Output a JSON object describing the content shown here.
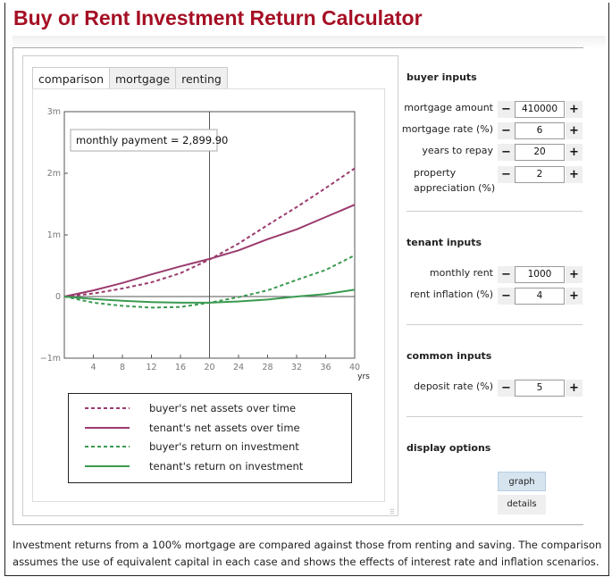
{
  "title": "Buy or Rent Investment Return Calculator",
  "tabs": [
    {
      "label": "comparison",
      "active": true
    },
    {
      "label": "mortgage"
    },
    {
      "label": "renting"
    }
  ],
  "annotation": "monthly payment = 2,899.90",
  "chart_data": {
    "type": "line",
    "xlabel": "yrs",
    "xlim": [
      0,
      40
    ],
    "ylim": [
      -1000000,
      3000000
    ],
    "xticks": [
      4,
      8,
      12,
      16,
      20,
      24,
      28,
      32,
      36,
      40
    ],
    "yticks": [
      {
        "v": 3000000,
        "label": "3m"
      },
      {
        "v": 2000000,
        "label": "2m"
      },
      {
        "v": 1000000,
        "label": "1m"
      },
      {
        "v": 0,
        "label": "0"
      },
      {
        "v": -1000000,
        "label": "−1m"
      }
    ],
    "vertical_marker_x": 20,
    "x": [
      0,
      4,
      8,
      12,
      16,
      20,
      24,
      28,
      32,
      36,
      40
    ],
    "series": [
      {
        "name": "buyer's net assets over time",
        "color": "#9b3b6e",
        "dashed": true,
        "values": [
          0,
          50000,
          130000,
          230000,
          380000,
          600000,
          860000,
          1160000,
          1450000,
          1760000,
          2080000
        ]
      },
      {
        "name": "tenant's net assets over time",
        "color": "#9b3b6e",
        "dashed": false,
        "values": [
          0,
          100000,
          220000,
          360000,
          490000,
          610000,
          750000,
          930000,
          1090000,
          1290000,
          1490000
        ]
      },
      {
        "name": "buyer's return on investment",
        "color": "#3a9a50",
        "dashed": true,
        "values": [
          0,
          -100000,
          -150000,
          -180000,
          -170000,
          -100000,
          -10000,
          100000,
          270000,
          430000,
          670000
        ]
      },
      {
        "name": "tenant's return on investment",
        "color": "#3a9a50",
        "dashed": false,
        "values": [
          0,
          -40000,
          -70000,
          -90000,
          -100000,
          -100000,
          -80000,
          -50000,
          0,
          40000,
          110000
        ]
      }
    ]
  },
  "buyer": {
    "heading": "buyer inputs",
    "fields": [
      {
        "label": "mortgage amount",
        "value": "410000"
      },
      {
        "label": "mortgage rate (%)",
        "value": "6"
      },
      {
        "label": "years to repay",
        "value": "20"
      },
      {
        "label": "property appreciation (%)",
        "value": "2"
      }
    ]
  },
  "tenant": {
    "heading": "tenant inputs",
    "fields": [
      {
        "label": "monthly rent",
        "value": "1000"
      },
      {
        "label": "rent inflation (%)",
        "value": "4"
      }
    ]
  },
  "common": {
    "heading": "common inputs",
    "fields": [
      {
        "label": "deposit rate (%)",
        "value": "5"
      }
    ]
  },
  "display": {
    "heading": "display options",
    "graph": "graph",
    "details": "details",
    "selected": "graph"
  },
  "stepper": {
    "minus": "−",
    "plus": "+"
  },
  "footer": "Investment returns from a 100% mortgage are compared against those from renting and saving. The comparison assumes the use of equivalent capital in each case and shows the effects of interest rate and inflation scenarios."
}
